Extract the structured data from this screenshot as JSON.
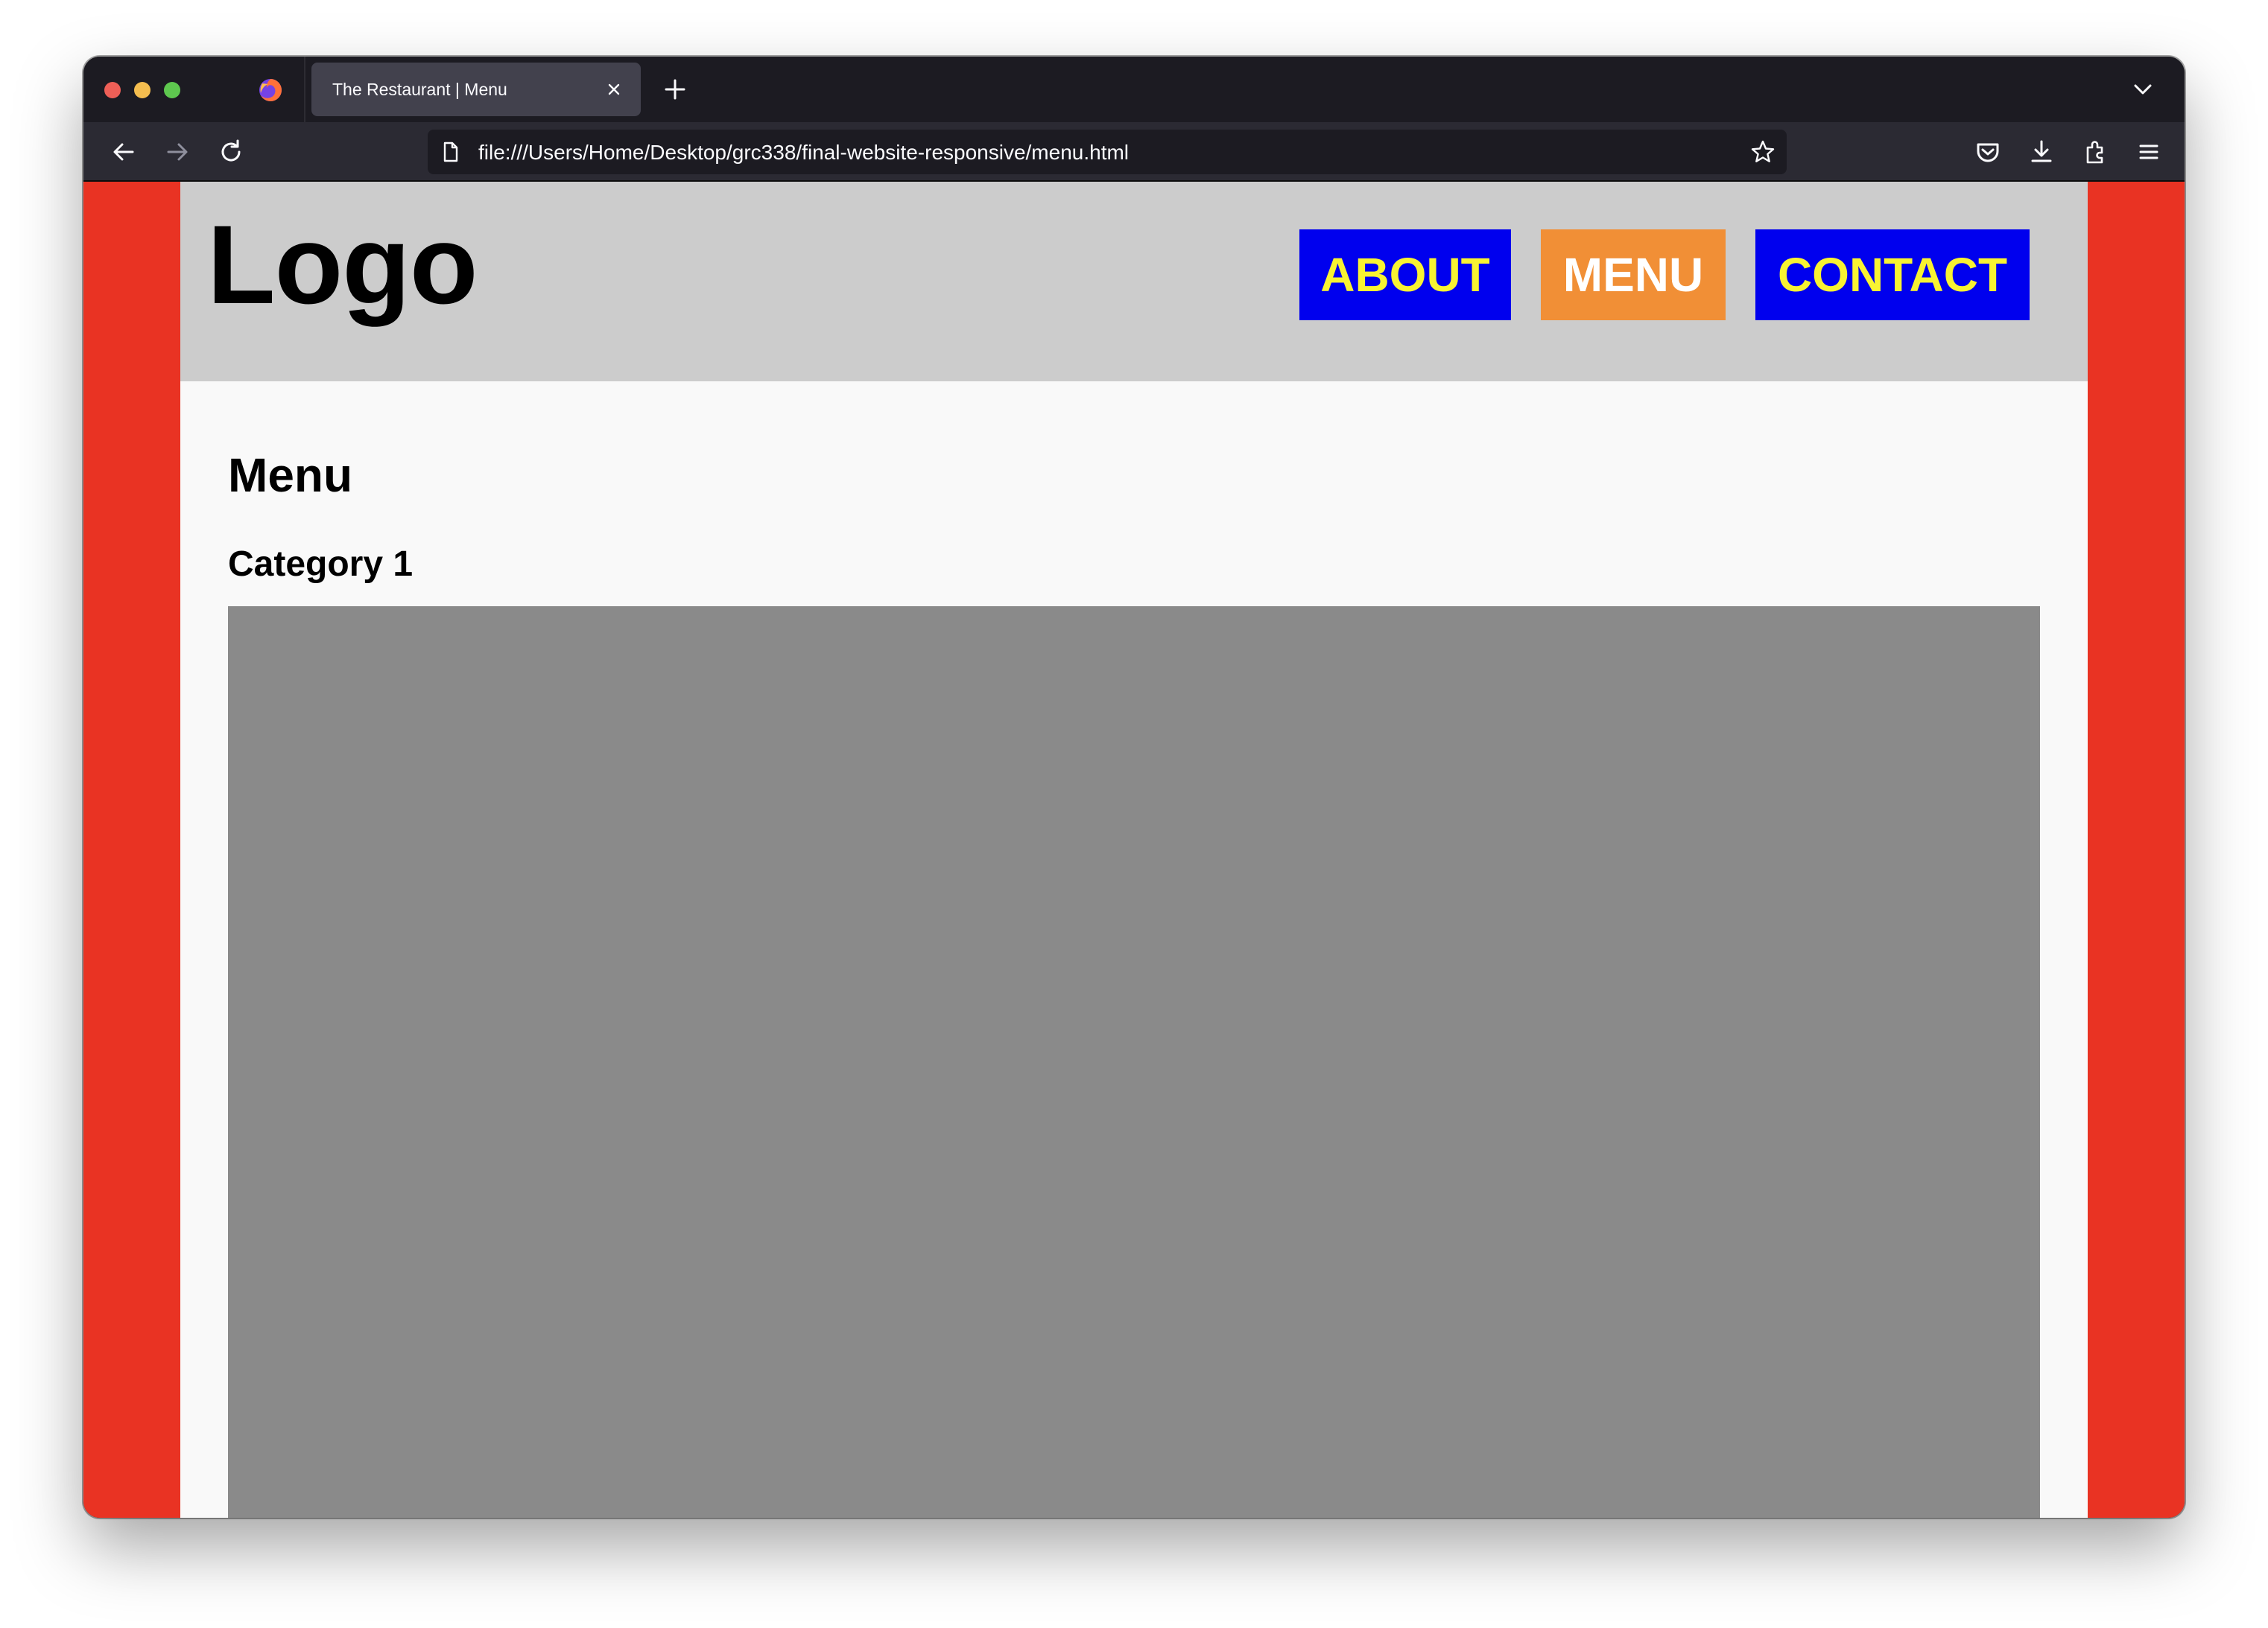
{
  "browser": {
    "tab": {
      "title": "The Restaurant | Menu"
    },
    "url": "file:///Users/Home/Desktop/grc338/final-website-responsive/menu.html",
    "icons": {
      "back": "arrow-left-icon",
      "forward": "arrow-right-icon",
      "reload": "reload-icon",
      "page": "page-icon",
      "bookmark": "star-icon",
      "pocket": "pocket-icon",
      "downloads": "download-icon",
      "extensions": "puzzle-icon",
      "menu": "hamburger-icon",
      "new_tab": "plus-icon",
      "tab_list": "chevron-down-icon",
      "tab_close": "close-icon"
    }
  },
  "site": {
    "logo": "Logo",
    "nav": [
      {
        "label": "ABOUT",
        "active": false
      },
      {
        "label": "MENU",
        "active": true
      },
      {
        "label": "CONTACT",
        "active": false
      }
    ],
    "heading": "Menu",
    "category": "Category 1",
    "colors": {
      "outer_background": "#e93323",
      "header_background": "#cccccc",
      "nav_background": "#0000ee",
      "nav_active_background": "#f18f36",
      "nav_text": "#f8f332",
      "nav_active_text": "#ffffff",
      "image_placeholder": "#8a8a8a"
    }
  }
}
